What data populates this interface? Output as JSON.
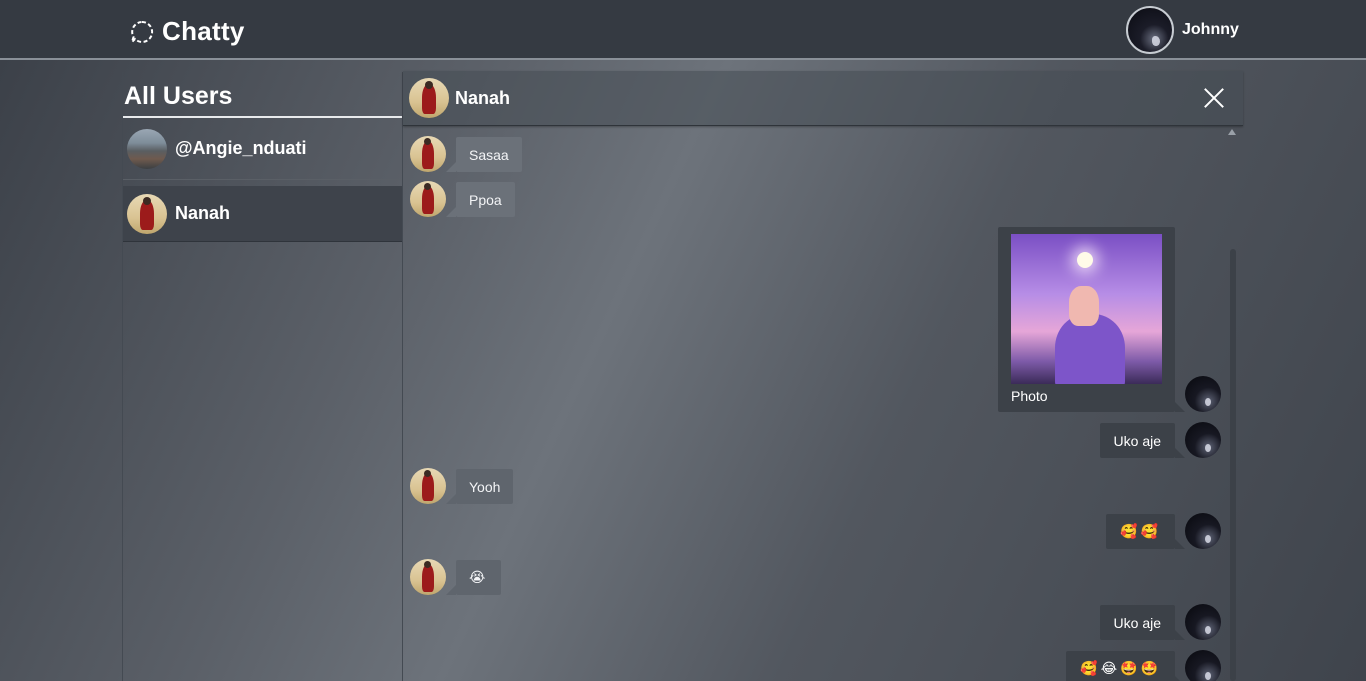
{
  "app": {
    "title": "Chatty"
  },
  "current_user": {
    "name": "Johnny"
  },
  "sidebar": {
    "title": "All Users",
    "users": [
      {
        "name": "@Angie_nduati",
        "active": false
      },
      {
        "name": "Nanah",
        "active": true
      }
    ]
  },
  "chat": {
    "contact_name": "Nanah",
    "messages": [
      {
        "direction": "in",
        "type": "text",
        "text": "Sasaa"
      },
      {
        "direction": "in",
        "type": "text",
        "text": "Ppoa"
      },
      {
        "direction": "out",
        "type": "photo",
        "caption": "Photo"
      },
      {
        "direction": "out",
        "type": "text",
        "text": "Uko aje"
      },
      {
        "direction": "in",
        "type": "text",
        "text": "Yooh"
      },
      {
        "direction": "out",
        "type": "text",
        "text": "🥰🥰"
      },
      {
        "direction": "in",
        "type": "text",
        "text": "😭"
      },
      {
        "direction": "out",
        "type": "text",
        "text": "Uko aje"
      },
      {
        "direction": "out",
        "type": "text",
        "text": "🥰😂🤩🤩"
      }
    ]
  }
}
